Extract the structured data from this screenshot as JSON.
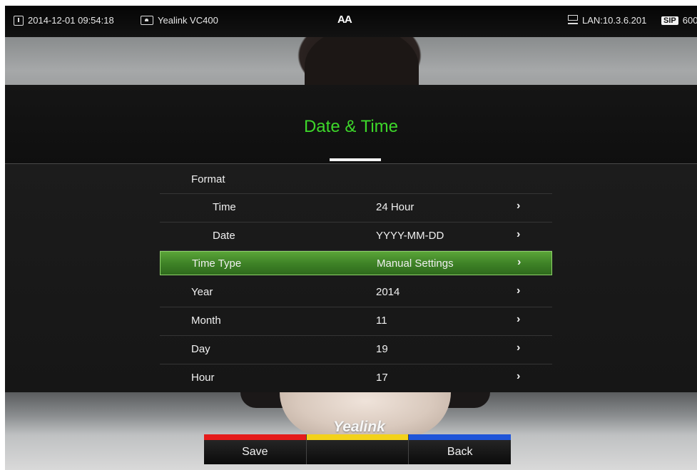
{
  "status_bar": {
    "datetime": "2014-12-01 09:54:18",
    "device_name": "Yealink VC400",
    "font_indicator": "AA",
    "lan": "LAN:10.3.6.201",
    "sip_badge": "SIP",
    "sip_account": "600"
  },
  "page": {
    "title": "Date & Time",
    "accent_color": "#3dd82a"
  },
  "menu": {
    "format_header": "Format",
    "rows": [
      {
        "label": "Time",
        "value": "24 Hour"
      },
      {
        "label": "Date",
        "value": "YYYY-MM-DD"
      },
      {
        "label": "Time Type",
        "value": "Manual Settings",
        "selected": true
      },
      {
        "label": "Year",
        "value": "2014"
      },
      {
        "label": "Month",
        "value": "11"
      },
      {
        "label": "Day",
        "value": "19"
      },
      {
        "label": "Hour",
        "value": "17"
      }
    ],
    "chevron": "›"
  },
  "brand_logo": "Yealink",
  "softkeys": {
    "save": "Save",
    "middle": "",
    "back": "Back",
    "colors": [
      "#e51b1b",
      "#f3d21a",
      "#1f55d8"
    ]
  }
}
